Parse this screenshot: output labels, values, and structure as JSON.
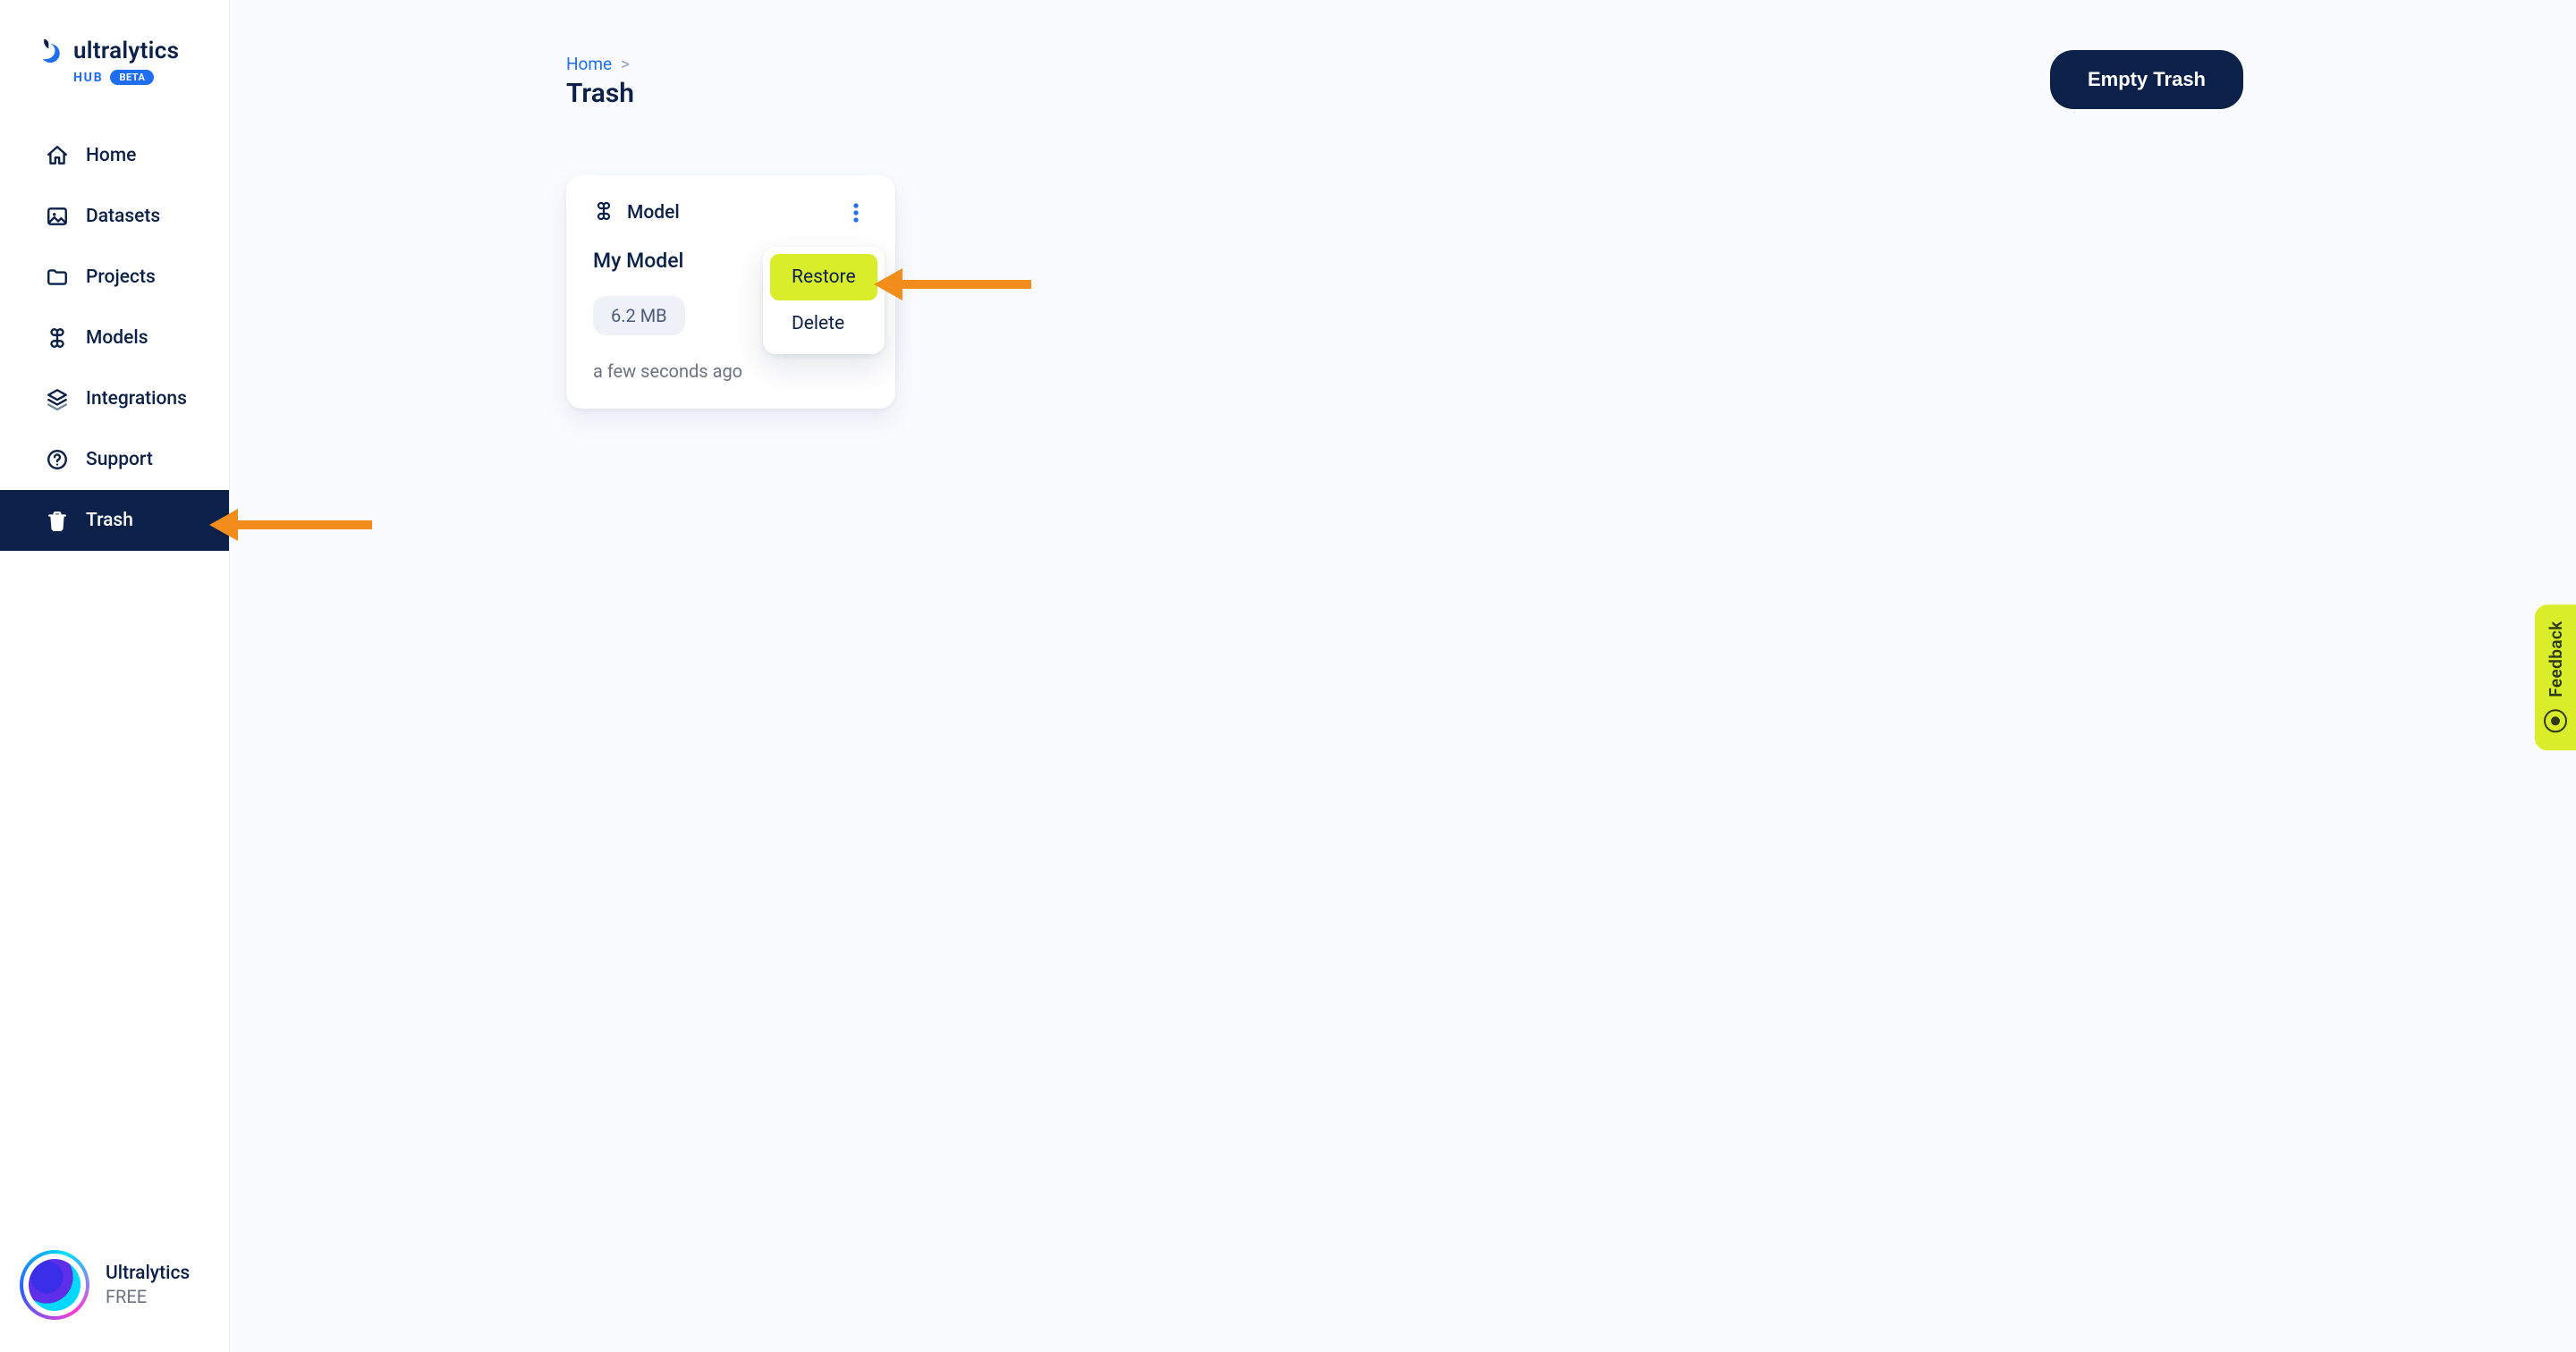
{
  "brand": {
    "name": "ultralytics",
    "sub_hub": "HUB",
    "sub_badge": "BETA"
  },
  "sidebar": {
    "items": [
      {
        "label": "Home",
        "icon": "home-icon"
      },
      {
        "label": "Datasets",
        "icon": "image-icon"
      },
      {
        "label": "Projects",
        "icon": "folder-icon"
      },
      {
        "label": "Models",
        "icon": "command-icon"
      },
      {
        "label": "Integrations",
        "icon": "layers-icon"
      },
      {
        "label": "Support",
        "icon": "help-icon"
      },
      {
        "label": "Trash",
        "icon": "trash-icon"
      }
    ],
    "active_index": 6,
    "user": {
      "name": "Ultralytics",
      "plan": "FREE"
    }
  },
  "breadcrumb": {
    "root": "Home",
    "sep": ">"
  },
  "page": {
    "title": "Trash"
  },
  "actions": {
    "empty_trash": "Empty Trash"
  },
  "card": {
    "type_label": "Model",
    "title": "My Model",
    "size": "6.2 MB",
    "time": "a few seconds ago"
  },
  "popover": {
    "restore": "Restore",
    "delete": "Delete"
  },
  "feedback": {
    "label": "Feedback"
  }
}
